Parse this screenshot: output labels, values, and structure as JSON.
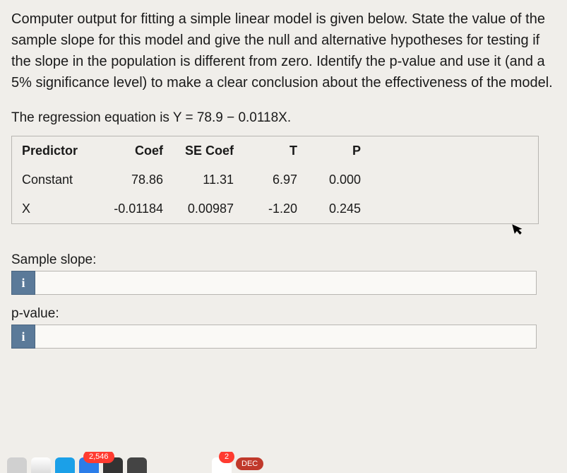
{
  "question": "Computer output for fitting a simple linear model is given below. State the value of the sample slope for this model and give the null and alternative hypotheses for testing if the slope in the population is different from zero. Identify the p-value and use it (and a 5% significance level) to make a clear conclusion about the effectiveness of the model.",
  "equation_prefix": "The regression equation is Y = ",
  "equation_value": "78.9 − 0.0118X.",
  "table": {
    "headers": {
      "predictor": "Predictor",
      "coef": "Coef",
      "se": "SE Coef",
      "t": "T",
      "p": "P"
    },
    "rows": [
      {
        "predictor": "Constant",
        "coef": "78.86",
        "se": "11.31",
        "t": "6.97",
        "p": "0.000"
      },
      {
        "predictor": "X",
        "coef": "-0.01184",
        "se": "0.00987",
        "t": "-1.20",
        "p": "0.245"
      }
    ]
  },
  "answers": {
    "slope_label": "Sample slope:",
    "pvalue_label": "p-value:",
    "info_icon": "i"
  },
  "dock": {
    "badge1": "2,546",
    "badge2": "2",
    "badge3": "DEC"
  },
  "chart_data": {
    "type": "table",
    "title": "Regression coefficients",
    "columns": [
      "Predictor",
      "Coef",
      "SE Coef",
      "T",
      "P"
    ],
    "rows": [
      [
        "Constant",
        78.86,
        11.31,
        6.97,
        0.0
      ],
      [
        "X",
        -0.01184,
        0.00987,
        -1.2,
        0.245
      ]
    ],
    "equation": "Y = 78.9 - 0.0118X"
  }
}
